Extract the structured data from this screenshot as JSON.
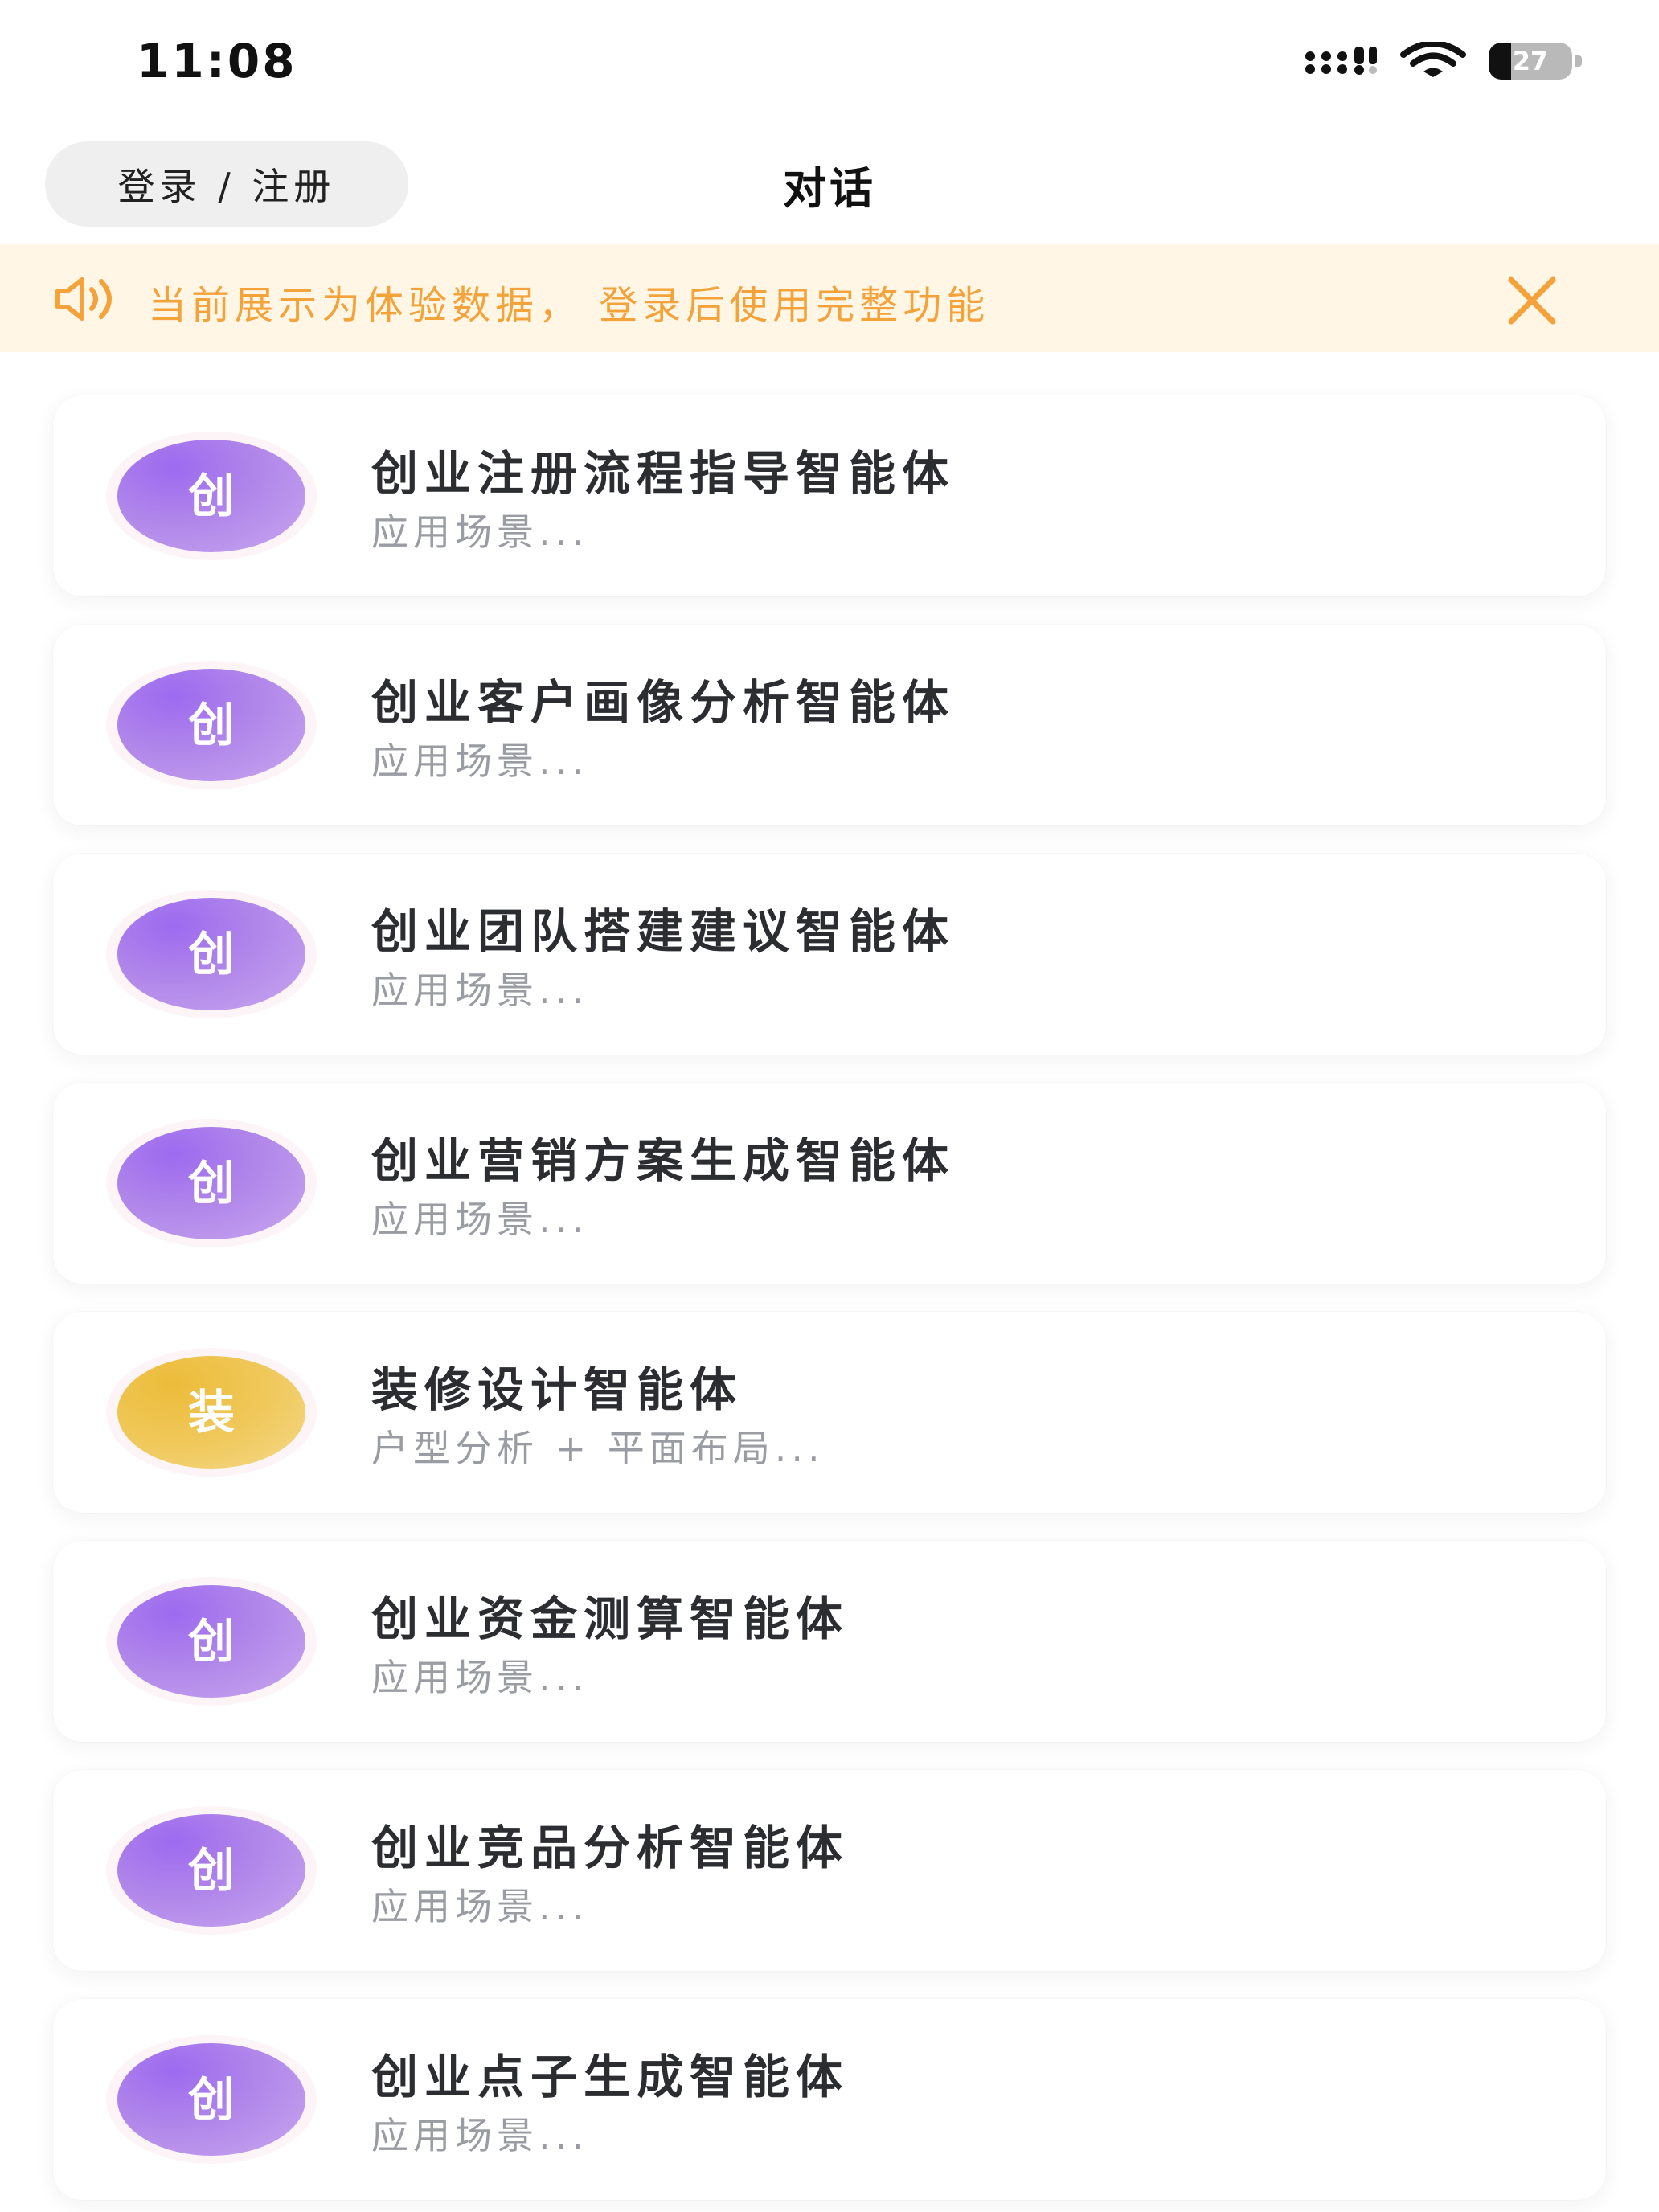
{
  "status_bar": {
    "time": "11:08",
    "battery": "27",
    "battery_level": 0.27,
    "icons": [
      "signal-icon",
      "wifi-icon",
      "battery-icon"
    ]
  },
  "header": {
    "login_label": "登录 / 注册",
    "title": "对话"
  },
  "notice": {
    "text": "当前展示为体验数据， 登录后使用完整功能",
    "icons": [
      "speaker-icon",
      "close-icon"
    ],
    "color": "#f4a23a",
    "background": "#fff6e6"
  },
  "agents": [
    {
      "avatar": "创",
      "title": "创业注册流程指导智能体",
      "subtitle": "应用场景...",
      "color": "purple"
    },
    {
      "avatar": "创",
      "title": "创业客户画像分析智能体",
      "subtitle": "应用场景...",
      "color": "purple"
    },
    {
      "avatar": "创",
      "title": "创业团队搭建建议智能体",
      "subtitle": "应用场景...",
      "color": "purple"
    },
    {
      "avatar": "创",
      "title": "创业营销方案生成智能体",
      "subtitle": "应用场景...",
      "color": "purple"
    },
    {
      "avatar": "装",
      "title": "装修设计智能体",
      "subtitle": "户型分析 + 平面布局...",
      "color": "gold"
    },
    {
      "avatar": "创",
      "title": "创业资金测算智能体",
      "subtitle": "应用场景...",
      "color": "purple"
    },
    {
      "avatar": "创",
      "title": "创业竞品分析智能体",
      "subtitle": "应用场景...",
      "color": "purple"
    },
    {
      "avatar": "创",
      "title": "创业点子生成智能体",
      "subtitle": "应用场景...",
      "color": "purple"
    }
  ],
  "colors": {
    "purple_avatar": "#a97be9",
    "gold_avatar": "#eec24d",
    "title_text": "#2b2d31",
    "subtitle_text": "#9a9ca3"
  }
}
